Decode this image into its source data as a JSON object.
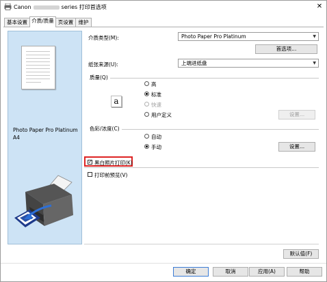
{
  "window": {
    "title_prefix": "Canon",
    "title_suffix": "series 打印首选项",
    "close_symbol": "✕"
  },
  "tabs": [
    {
      "label": "基本设置"
    },
    {
      "label": "介质/质量"
    },
    {
      "label": "页设置"
    },
    {
      "label": "维护"
    }
  ],
  "active_tab": 1,
  "preview": {
    "media_name": "Photo Paper Pro Platinum",
    "paper_size": "A4"
  },
  "media_type": {
    "label": "介质类型(M):",
    "value": "Photo Paper Pro Platinum"
  },
  "preferences_button": "首选项...",
  "paper_source": {
    "label": "纸张来源(U):",
    "value": "上端进纸盘"
  },
  "quality": {
    "label": "质量(Q)",
    "options": [
      {
        "label": "高",
        "selected": false,
        "enabled": true
      },
      {
        "label": "标准",
        "selected": true,
        "enabled": true
      },
      {
        "label": "快速",
        "selected": false,
        "enabled": false
      },
      {
        "label": "用户定义",
        "selected": false,
        "enabled": true
      }
    ],
    "icon_glyph": "a",
    "set_button": "设置..."
  },
  "color": {
    "label": "色彩/浓度(C)",
    "options": [
      {
        "label": "自动",
        "selected": false
      },
      {
        "label": "手动",
        "selected": true
      }
    ],
    "set_button": "设置..."
  },
  "grayscale": {
    "label": "黑白照片打印(K)",
    "checked": true
  },
  "print_preview": {
    "label": "打印前预览(V)",
    "checked": false
  },
  "defaults_button": "默认值(F)",
  "footer": {
    "ok": "确定",
    "cancel": "取消",
    "apply": "应用(A)",
    "help": "帮助"
  },
  "colors": {
    "preview_bg": "#cde3f5",
    "highlight": "#dd2222"
  }
}
